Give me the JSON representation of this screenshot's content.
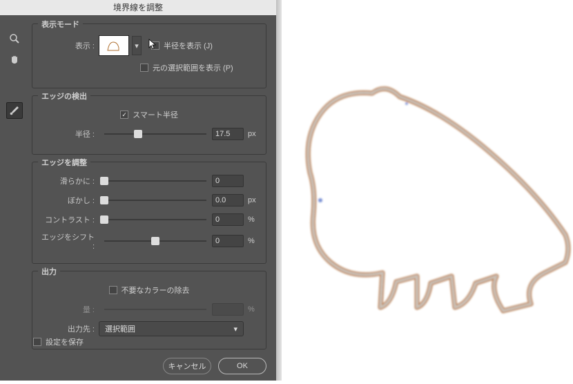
{
  "window": {
    "title": "境界線を調整"
  },
  "view_mode": {
    "title": "表示モード",
    "show_label": "表示 :",
    "show_radius_label": "半径を表示 (J)",
    "show_radius_checked": false,
    "show_original_label": "元の選択範囲を表示 (P)",
    "show_original_checked": false
  },
  "edge_detect": {
    "title": "エッジの検出",
    "smart_radius_label": "スマート半径",
    "smart_radius_checked": true,
    "radius_label": "半径 :",
    "radius_value": "17.5",
    "radius_unit": "px",
    "radius_pct": 33
  },
  "edge_adjust": {
    "title": "エッジを調整",
    "smooth": {
      "label": "滑らかに :",
      "value": "0",
      "pct": 0
    },
    "feather": {
      "label": "ぼかし :",
      "value": "0.0",
      "unit": "px",
      "pct": 0
    },
    "contrast": {
      "label": "コントラスト :",
      "value": "0",
      "unit": "%",
      "pct": 0
    },
    "shift": {
      "label": "エッジをシフト :",
      "value": "0",
      "unit": "%",
      "pct": 50
    }
  },
  "output": {
    "title": "出力",
    "decontaminate_label": "不要なカラーの除去",
    "decontaminate_checked": false,
    "amount_label": "量 :",
    "amount_unit": "%",
    "dest_label": "出力先 :",
    "dest_value": "選択範囲"
  },
  "save_settings": {
    "label": "設定を保存",
    "checked": false
  },
  "buttons": {
    "cancel": "キャンセル",
    "ok": "OK"
  },
  "icons": {
    "zoom": "zoom-icon",
    "hand": "hand-icon",
    "brush": "brush-icon",
    "caret_down": "▾",
    "cursor": "cursor-icon"
  }
}
